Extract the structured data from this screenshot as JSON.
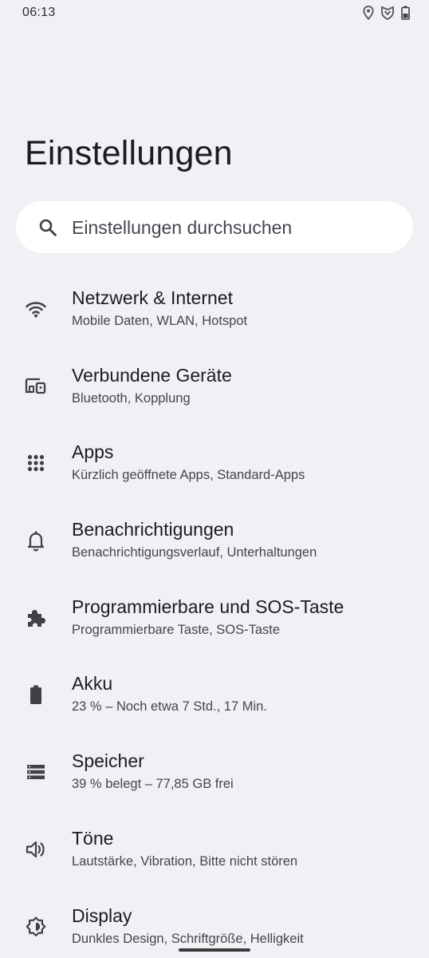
{
  "status_bar": {
    "time": "06:13",
    "icons": [
      "location-icon",
      "vpn-shield-icon",
      "battery-icon"
    ]
  },
  "header": {
    "title": "Einstellungen"
  },
  "search": {
    "placeholder": "Einstellungen durchsuchen",
    "icon": "search-icon"
  },
  "settings": {
    "items": [
      {
        "title": "Netzwerk & Internet",
        "subtitle": "Mobile Daten, WLAN, Hotspot",
        "icon": "wifi-icon"
      },
      {
        "title": "Verbundene Geräte",
        "subtitle": "Bluetooth, Kopplung",
        "icon": "connected-devices-icon"
      },
      {
        "title": "Apps",
        "subtitle": "Kürzlich geöffnete Apps, Standard-Apps",
        "icon": "apps-grid-icon"
      },
      {
        "title": "Benachrichtigungen",
        "subtitle": "Benachrichtigungsverlauf, Unterhaltungen",
        "icon": "bell-icon"
      },
      {
        "title": "Programmierbare und SOS-Taste",
        "subtitle": "Programmierbare Taste, SOS-Taste",
        "icon": "puzzle-icon"
      },
      {
        "title": "Akku",
        "subtitle": "23 % – Noch etwa 7 Std., 17 Min.",
        "icon": "battery-icon"
      },
      {
        "title": "Speicher",
        "subtitle": "39 % belegt – 77,85 GB frei",
        "icon": "storage-icon"
      },
      {
        "title": "Töne",
        "subtitle": "Lautstärke, Vibration, Bitte nicht stören",
        "icon": "volume-icon"
      },
      {
        "title": "Display",
        "subtitle": "Dunkles Design, Schriftgröße, Helligkeit",
        "icon": "brightness-icon"
      }
    ]
  },
  "colors": {
    "background": "#f1f0f4",
    "search_background": "#ffffff",
    "text_primary": "#1c1b1f",
    "text_secondary": "#44464e",
    "icon": "#3f4048"
  }
}
